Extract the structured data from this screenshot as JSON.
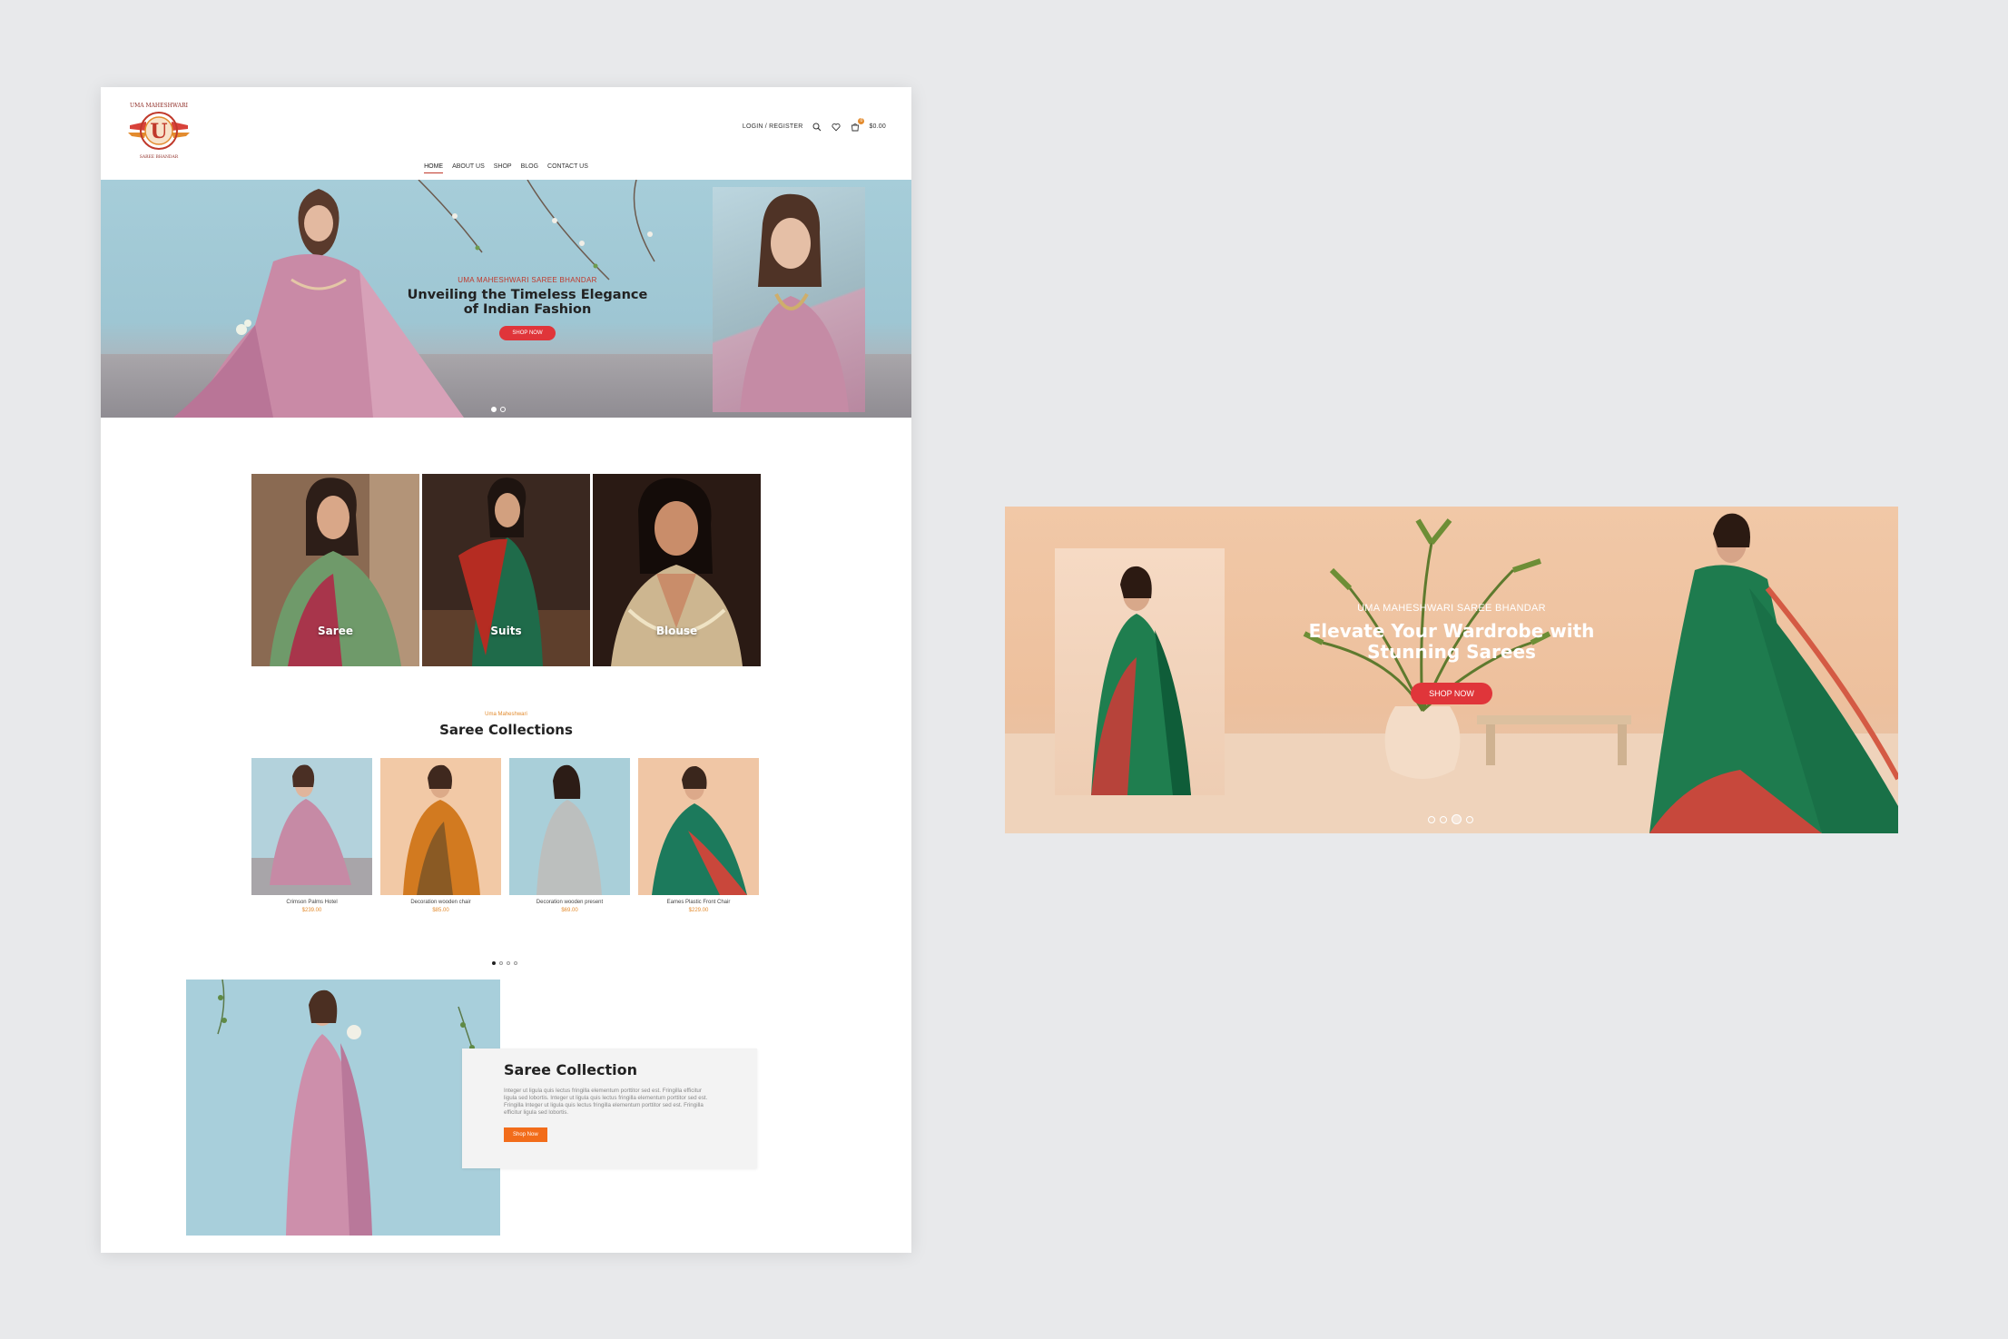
{
  "brand": {
    "logo_text_top": "UMA MAHESHWARI",
    "logo_text_bottom": "SAREE BHANDAR",
    "logo_monogram": "U"
  },
  "header": {
    "login_label": "LOGIN / REGISTER",
    "cart_count": "0",
    "cart_total": "$0.00",
    "icons": [
      "search-icon",
      "heart-icon",
      "cart-icon"
    ]
  },
  "nav": {
    "items": [
      {
        "label": "HOME",
        "active": true
      },
      {
        "label": "ABOUT US"
      },
      {
        "label": "SHOP"
      },
      {
        "label": "BLOG"
      },
      {
        "label": "CONTACT US"
      }
    ]
  },
  "hero": {
    "kicker": "UMA MAHESHWARI SAREE BHANDAR",
    "title_line1": "Unveiling the Timeless Elegance",
    "title_line2": "of Indian Fashion",
    "button": "SHOP NOW"
  },
  "categories": [
    {
      "label": "Saree"
    },
    {
      "label": "Suits"
    },
    {
      "label": "Blouse"
    }
  ],
  "collection": {
    "kicker": "Uma Maheshwari",
    "title": "Saree Collections",
    "products": [
      {
        "name": "Crimson Palms Hotel",
        "price": "$239.00"
      },
      {
        "name": "Decoration wooden chair",
        "price": "$85.00"
      },
      {
        "name": "Decoration wooden present",
        "price": "$69.00"
      },
      {
        "name": "Eames Plastic Front Chair",
        "price": "$229.00"
      }
    ]
  },
  "feature": {
    "title": "Saree Collection",
    "body": "Integer ut ligula quis lectus fringilla elementum porttitor sed est. Fringilla efficitur ligula sed lobortis. Integer ut ligula quis lectus fringilla elementum porttitor sed est. Fringilla Integer ut ligula quis lectus fringilla elementum porttitor sed est. Fringilla efficitur ligula sed lobortis.",
    "button": "Shop Now"
  },
  "banner": {
    "kicker": "UMA MAHESHWARI SAREE BHANDAR",
    "title_line1": "Elevate Your Wardrobe with",
    "title_line2": "Stunning Sarees",
    "button": "SHOP NOW"
  },
  "colors": {
    "accent_red": "#e0353a",
    "accent_orange": "#f26c1a",
    "price_orange": "#e38b2e",
    "hero_blue": "#a6cdd9",
    "banner_peach": "#f1c8a7"
  }
}
